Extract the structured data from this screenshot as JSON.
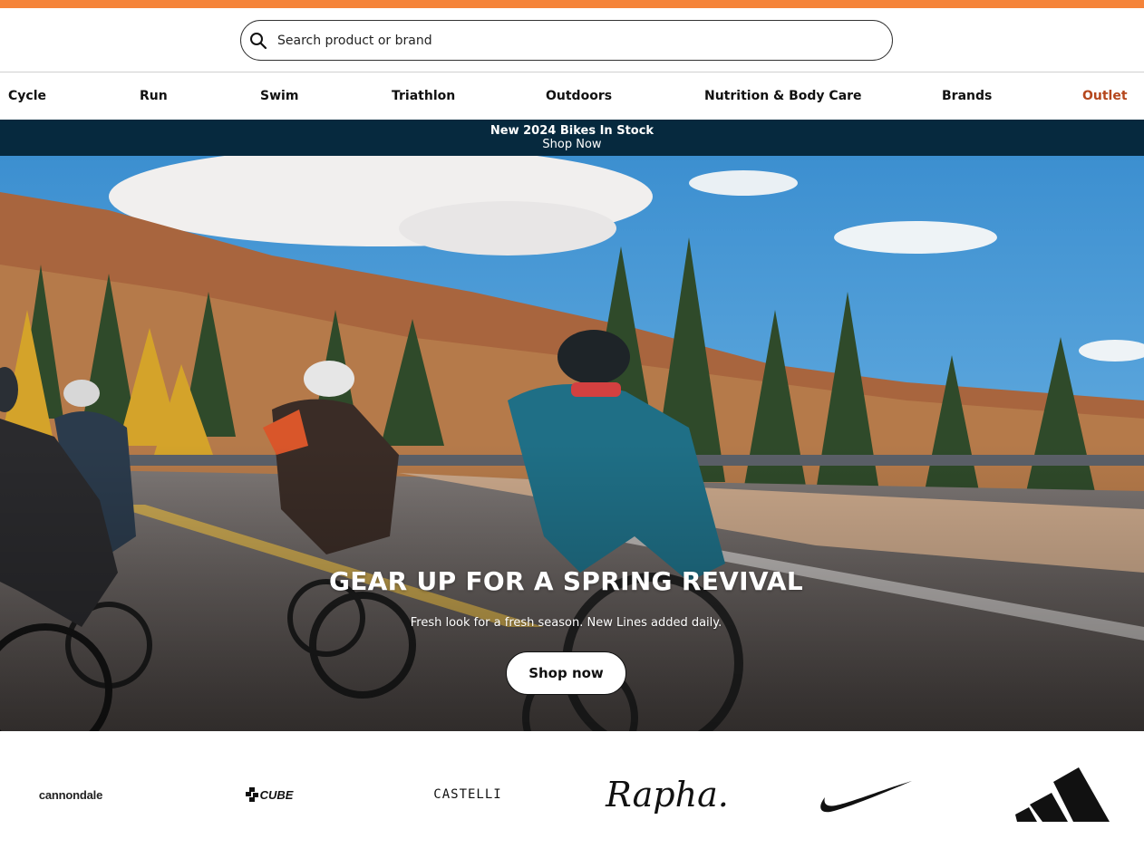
{
  "search": {
    "placeholder": "Search product or brand",
    "icon": "search-icon"
  },
  "nav": {
    "items": [
      {
        "label": "Cycle"
      },
      {
        "label": "Run"
      },
      {
        "label": "Swim"
      },
      {
        "label": "Triathlon"
      },
      {
        "label": "Outdoors"
      },
      {
        "label": "Nutrition & Body Care"
      },
      {
        "label": "Brands"
      },
      {
        "label": "Outlet"
      }
    ]
  },
  "promo": {
    "title": "New 2024 Bikes In Stock",
    "link": "Shop Now"
  },
  "hero": {
    "title": "GEAR UP FOR A SPRING REVIVAL",
    "subtitle": "Fresh look for a fresh season. New Lines added daily.",
    "button": "Shop now"
  },
  "brands": {
    "cannondale": "cannondale",
    "cube": "CUBE",
    "castelli": "CASTELLI",
    "rapha": "Rapha.",
    "nike": "nike-swoosh-logo",
    "adidas": "adidas-logo"
  },
  "colors": {
    "accent": "#f5843a",
    "promo_bg": "#06293e",
    "outlet": "#b5471d"
  }
}
